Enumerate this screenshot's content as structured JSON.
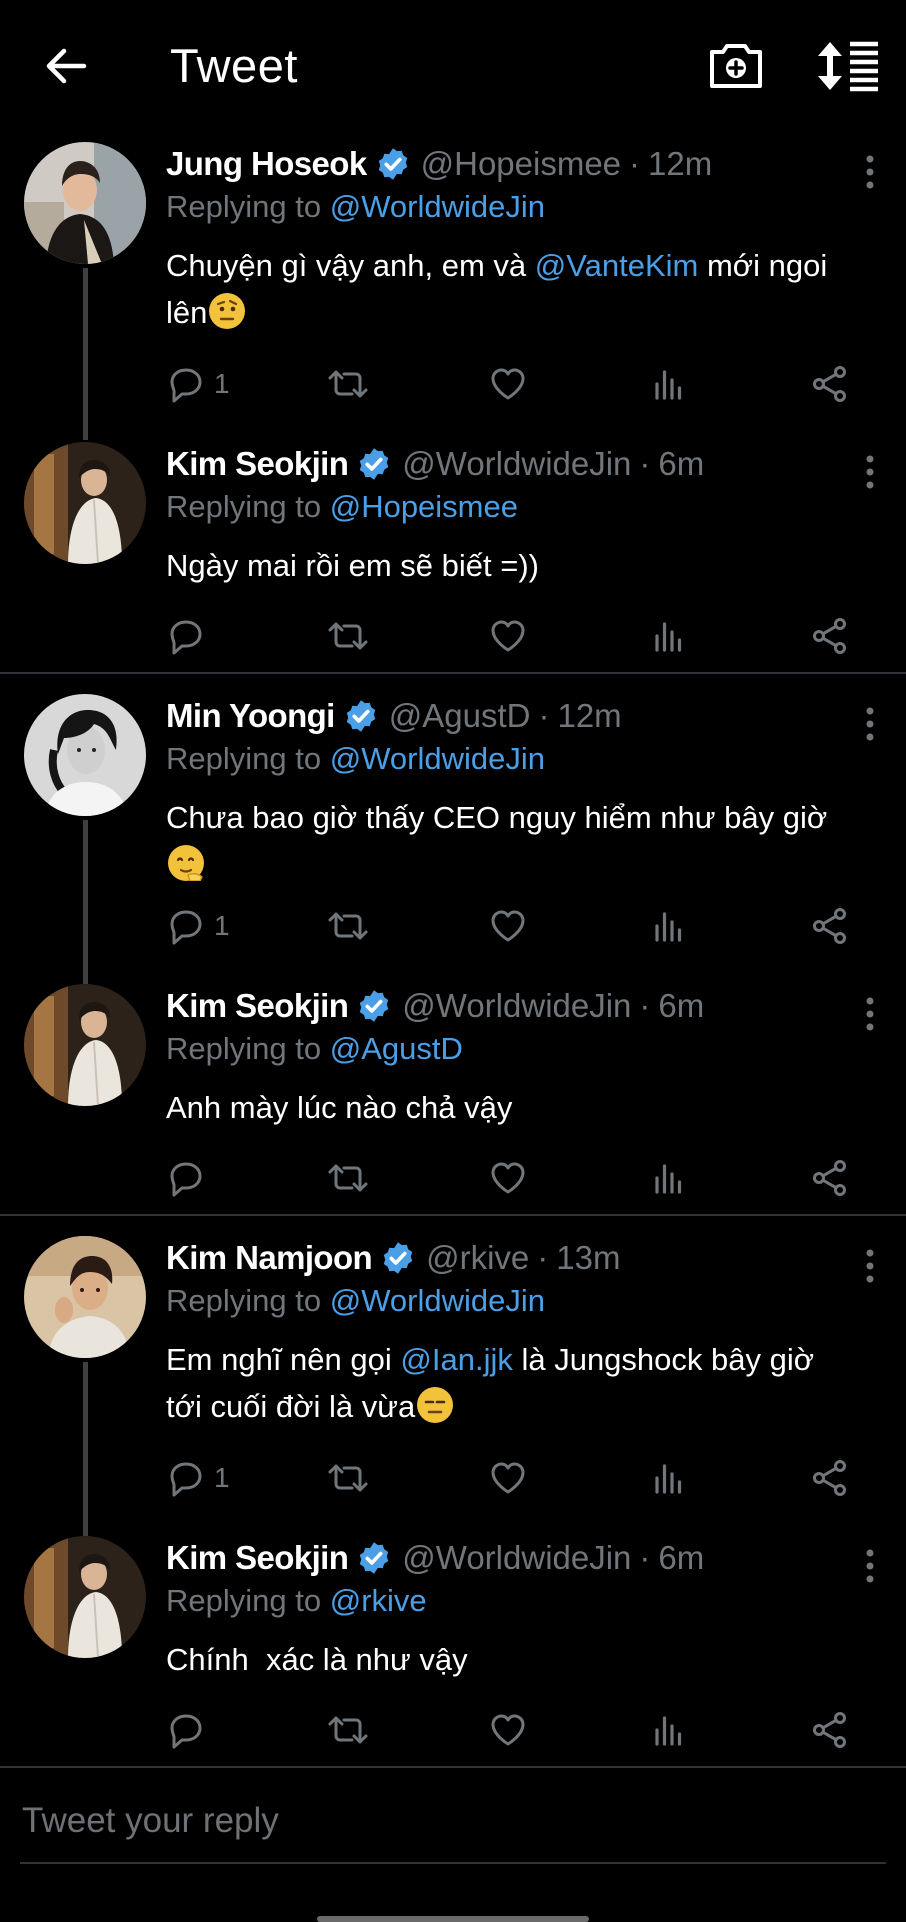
{
  "header": {
    "title": "Tweet"
  },
  "tweets": [
    {
      "name": "Jung Hoseok",
      "handle": "@Hopeismee",
      "time": "12m",
      "replying_label": "Replying to",
      "reply_to": "@WorldwideJin",
      "text_parts": [
        "Chuyện gì vậy anh, em và ",
        "@VanteKim",
        " mới ngoi",
        "lên"
      ],
      "emoji": "face-with-raised-eyebrow",
      "reply_count": "1"
    },
    {
      "name": "Kim Seokjin",
      "handle": "@WorldwideJin",
      "time": "6m",
      "replying_label": "Replying to",
      "reply_to": "@Hopeismee",
      "text": "Ngày mai rồi em sẽ biết =))",
      "reply_count": ""
    },
    {
      "name": "Min Yoongi",
      "handle": "@AgustD",
      "time": "12m",
      "replying_label": "Replying to",
      "reply_to": "@WorldwideJin",
      "text": "Chưa bao giờ thấy CEO nguy hiểm như bây giờ",
      "emoji": "saluting-face",
      "reply_count": "1"
    },
    {
      "name": "Kim Seokjin",
      "handle": "@WorldwideJin",
      "time": "6m",
      "replying_label": "Replying to",
      "reply_to": "@AgustD",
      "text": "Anh mày lúc nào chả vậy",
      "reply_count": ""
    },
    {
      "name": "Kim Namjoon",
      "handle": "@rkive",
      "time": "13m",
      "replying_label": "Replying to",
      "reply_to": "@WorldwideJin",
      "text_parts": [
        "Em nghĩ nên gọi ",
        "@Ian.jjk",
        " là Jungshock bây giờ",
        "tới cuối đời là vừa"
      ],
      "emoji": "expressionless-face",
      "reply_count": "1"
    },
    {
      "name": "Kim Seokjin",
      "handle": "@WorldwideJin",
      "time": "6m",
      "replying_label": "Replying to",
      "reply_to": "@rkive",
      "text": "Chính  xác là như vậy",
      "reply_count": ""
    }
  ],
  "reply_box": {
    "placeholder": "Tweet your reply"
  },
  "colors": {
    "background": "#000000",
    "accent": "#4b9fe7",
    "muted": "#71767b",
    "verified": "#4b9fe7"
  },
  "icons": [
    "back-arrow-icon",
    "camera-plus-icon",
    "sort-icon",
    "verified-badge-icon",
    "more-vertical-icon",
    "reply-icon",
    "retweet-icon",
    "like-icon",
    "analytics-icon",
    "share-icon"
  ]
}
